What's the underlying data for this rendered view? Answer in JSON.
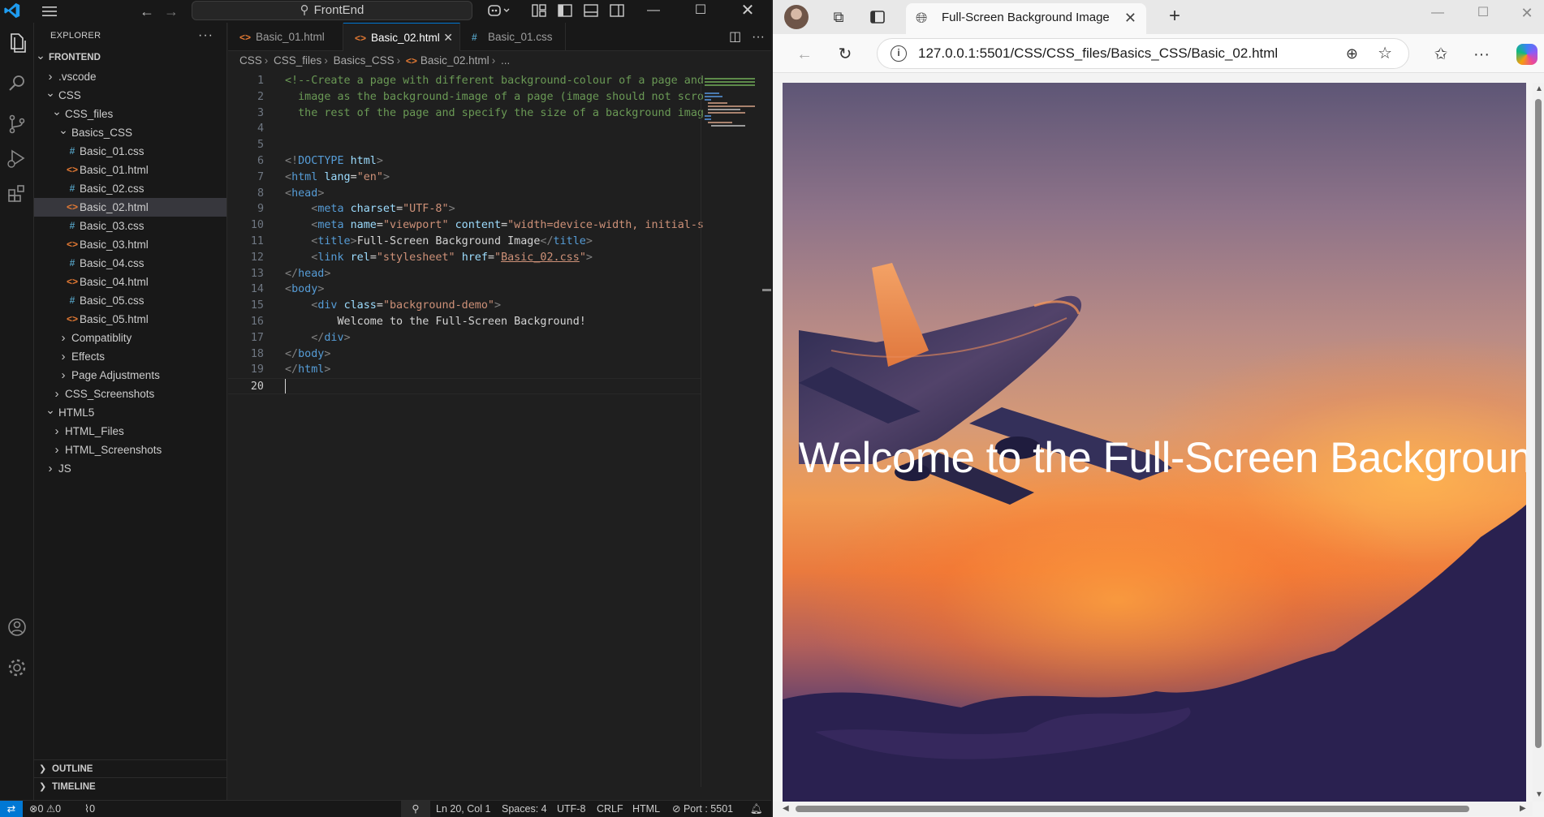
{
  "vscode": {
    "search": "FrontEnd",
    "explorer_title": "EXPLORER",
    "tree": [
      {
        "label": "FRONTEND",
        "depth": 0,
        "type": "folder-open",
        "root": true
      },
      {
        "label": ".vscode",
        "depth": 1,
        "type": "folder"
      },
      {
        "label": "CSS",
        "depth": 1,
        "type": "folder-open"
      },
      {
        "label": "CSS_files",
        "depth": 2,
        "type": "folder-open"
      },
      {
        "label": "Basics_CSS",
        "depth": 3,
        "type": "folder-open"
      },
      {
        "label": "Basic_01.css",
        "depth": 4,
        "type": "css"
      },
      {
        "label": "Basic_01.html",
        "depth": 4,
        "type": "html"
      },
      {
        "label": "Basic_02.css",
        "depth": 4,
        "type": "css"
      },
      {
        "label": "Basic_02.html",
        "depth": 4,
        "type": "html",
        "selected": true
      },
      {
        "label": "Basic_03.css",
        "depth": 4,
        "type": "css"
      },
      {
        "label": "Basic_03.html",
        "depth": 4,
        "type": "html"
      },
      {
        "label": "Basic_04.css",
        "depth": 4,
        "type": "css"
      },
      {
        "label": "Basic_04.html",
        "depth": 4,
        "type": "html"
      },
      {
        "label": "Basic_05.css",
        "depth": 4,
        "type": "css"
      },
      {
        "label": "Basic_05.html",
        "depth": 4,
        "type": "html"
      },
      {
        "label": "Compatiblity",
        "depth": 3,
        "type": "folder"
      },
      {
        "label": "Effects",
        "depth": 3,
        "type": "folder"
      },
      {
        "label": "Page Adjustments",
        "depth": 3,
        "type": "folder"
      },
      {
        "label": "CSS_Screenshots",
        "depth": 2,
        "type": "folder"
      },
      {
        "label": "HTML5",
        "depth": 1,
        "type": "folder-open"
      },
      {
        "label": "HTML_Files",
        "depth": 2,
        "type": "folder"
      },
      {
        "label": "HTML_Screenshots",
        "depth": 2,
        "type": "folder"
      },
      {
        "label": "JS",
        "depth": 1,
        "type": "folder"
      }
    ],
    "outline_label": "OUTLINE",
    "timeline_label": "TIMELINE",
    "tabs": [
      {
        "label": "Basic_01.html",
        "icon": "html"
      },
      {
        "label": "Basic_02.html",
        "icon": "html",
        "active": true
      },
      {
        "label": "Basic_01.css",
        "icon": "css"
      }
    ],
    "breadcrumb": [
      "CSS",
      "CSS_files",
      "Basics_CSS",
      "Basic_02.html",
      "..."
    ],
    "code_lines": [
      [
        [
          "c-com",
          "<!--Create a page with different background-colour of a page and"
        ]
      ],
      [
        [
          "c-com",
          "  image as the background-image of a page (image should not scro"
        ]
      ],
      [
        [
          "c-com",
          "  the rest of the page and specify the size of a background imag"
        ]
      ],
      [],
      [],
      [
        [
          "c-brk",
          "<!"
        ],
        [
          "c-tag",
          "DOCTYPE"
        ],
        [
          "c-txt",
          " "
        ],
        [
          "c-att",
          "html"
        ],
        [
          "c-brk",
          ">"
        ]
      ],
      [
        [
          "c-brk",
          "<"
        ],
        [
          "c-tag",
          "html"
        ],
        [
          "c-txt",
          " "
        ],
        [
          "c-att",
          "lang"
        ],
        [
          "c-txt",
          "="
        ],
        [
          "c-str",
          "\"en\""
        ],
        [
          "c-brk",
          ">"
        ]
      ],
      [
        [
          "c-brk",
          "<"
        ],
        [
          "c-tag",
          "head"
        ],
        [
          "c-brk",
          ">"
        ]
      ],
      [
        [
          "c-txt",
          "    "
        ],
        [
          "c-brk",
          "<"
        ],
        [
          "c-tag",
          "meta"
        ],
        [
          "c-txt",
          " "
        ],
        [
          "c-att",
          "charset"
        ],
        [
          "c-txt",
          "="
        ],
        [
          "c-str",
          "\"UTF-8\""
        ],
        [
          "c-brk",
          ">"
        ]
      ],
      [
        [
          "c-txt",
          "    "
        ],
        [
          "c-brk",
          "<"
        ],
        [
          "c-tag",
          "meta"
        ],
        [
          "c-txt",
          " "
        ],
        [
          "c-att",
          "name"
        ],
        [
          "c-txt",
          "="
        ],
        [
          "c-str",
          "\"viewport\""
        ],
        [
          "c-txt",
          " "
        ],
        [
          "c-att",
          "content"
        ],
        [
          "c-txt",
          "="
        ],
        [
          "c-str",
          "\"width=device-width, initial-s"
        ]
      ],
      [
        [
          "c-txt",
          "    "
        ],
        [
          "c-brk",
          "<"
        ],
        [
          "c-tag",
          "title"
        ],
        [
          "c-brk",
          ">"
        ],
        [
          "c-txt",
          "Full-Screen Background Image"
        ],
        [
          "c-brk",
          "</"
        ],
        [
          "c-tag",
          "title"
        ],
        [
          "c-brk",
          ">"
        ]
      ],
      [
        [
          "c-txt",
          "    "
        ],
        [
          "c-brk",
          "<"
        ],
        [
          "c-tag",
          "link"
        ],
        [
          "c-txt",
          " "
        ],
        [
          "c-att",
          "rel"
        ],
        [
          "c-txt",
          "="
        ],
        [
          "c-str",
          "\"stylesheet\""
        ],
        [
          "c-txt",
          " "
        ],
        [
          "c-att",
          "href"
        ],
        [
          "c-txt",
          "="
        ],
        [
          "c-str",
          "\""
        ],
        [
          "c-link",
          "Basic_02.css"
        ],
        [
          "c-str",
          "\""
        ],
        [
          "c-brk",
          ">"
        ]
      ],
      [
        [
          "c-brk",
          "</"
        ],
        [
          "c-tag",
          "head"
        ],
        [
          "c-brk",
          ">"
        ]
      ],
      [
        [
          "c-brk",
          "<"
        ],
        [
          "c-tag",
          "body"
        ],
        [
          "c-brk",
          ">"
        ]
      ],
      [
        [
          "c-txt",
          "    "
        ],
        [
          "c-brk",
          "<"
        ],
        [
          "c-tag",
          "div"
        ],
        [
          "c-txt",
          " "
        ],
        [
          "c-att",
          "class"
        ],
        [
          "c-txt",
          "="
        ],
        [
          "c-str",
          "\"background-demo\""
        ],
        [
          "c-brk",
          ">"
        ]
      ],
      [
        [
          "c-txt",
          "        Welcome to the Full-Screen Background!"
        ]
      ],
      [
        [
          "c-txt",
          "    "
        ],
        [
          "c-brk",
          "</"
        ],
        [
          "c-tag",
          "div"
        ],
        [
          "c-brk",
          ">"
        ]
      ],
      [
        [
          "c-brk",
          "</"
        ],
        [
          "c-tag",
          "body"
        ],
        [
          "c-brk",
          ">"
        ]
      ],
      [
        [
          "c-brk",
          "</"
        ],
        [
          "c-tag",
          "html"
        ],
        [
          "c-brk",
          ">"
        ]
      ],
      []
    ],
    "status": {
      "errors": "0",
      "warnings": "0",
      "ports": "0",
      "position": "Ln 20, Col 1",
      "spaces": "Spaces: 4",
      "encoding": "UTF-8",
      "eol": "CRLF",
      "language": "HTML",
      "port": "Port : 5501"
    }
  },
  "browser": {
    "tab_title": "Full-Screen Background Image",
    "url": "127.0.0.1:5501/CSS/CSS_files/Basics_CSS/Basic_02.html",
    "page_heading": "Welcome to the Full-Screen Background"
  }
}
